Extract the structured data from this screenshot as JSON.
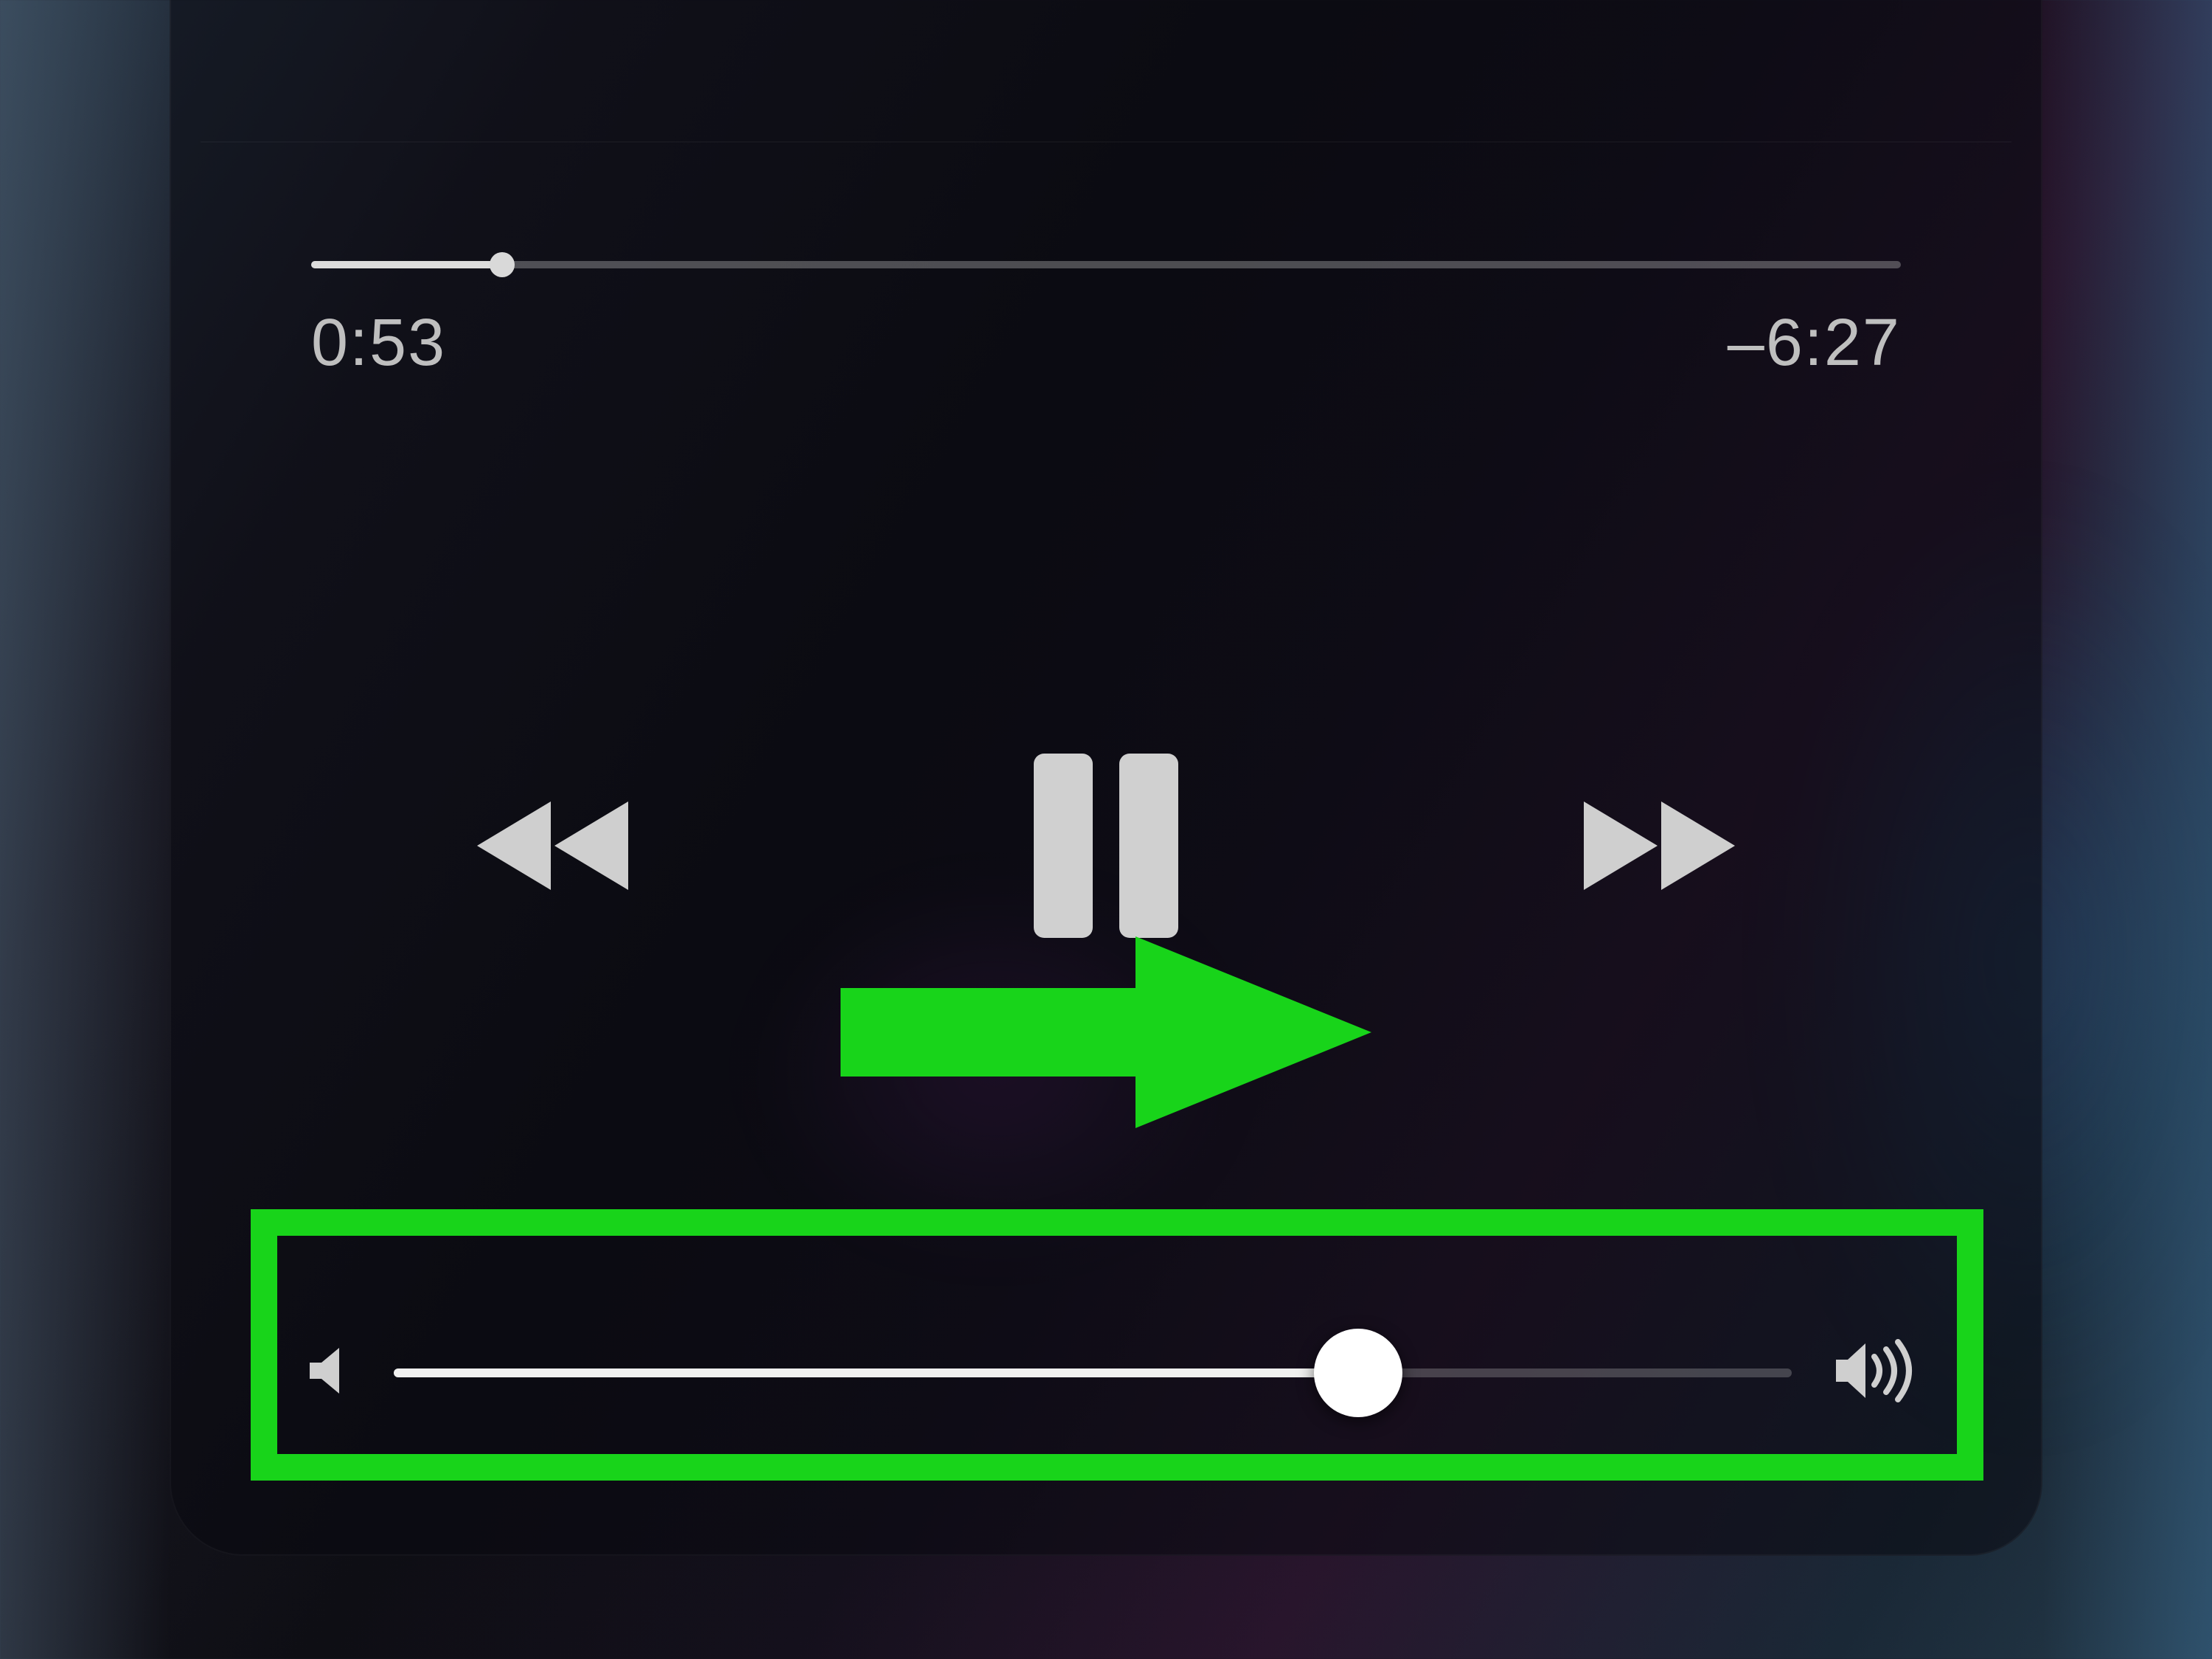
{
  "track_info": {
    "left_text": "—",
    "right_text": "—"
  },
  "scrubber": {
    "elapsed": "0:53",
    "remaining": "–6:27",
    "progress_pct": 12
  },
  "volume": {
    "level_pct": 69
  },
  "colors": {
    "highlight_green": "#18d41a",
    "annotation_arrow": "#18d41a",
    "control_icon": "#cfcfcf"
  },
  "annotation": {
    "target": "volume-slider",
    "meaning": "drag-right"
  }
}
